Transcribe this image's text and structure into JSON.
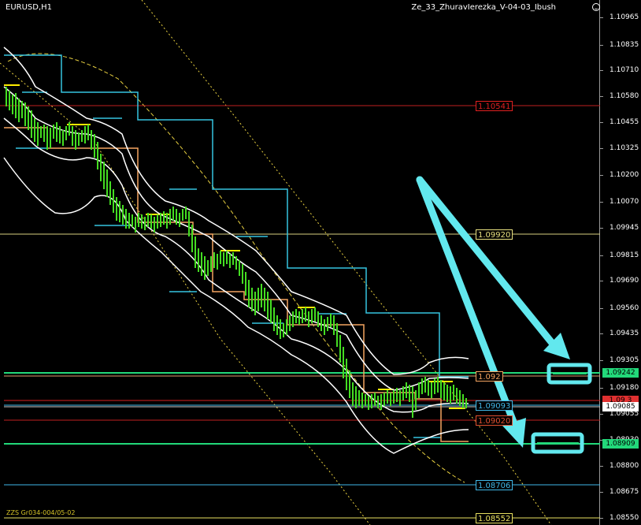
{
  "window": {
    "symbol": "EURUSD,H1",
    "indicator": "Ze_33_ZhuravIerezka_V-04-03_Ibush",
    "bottom_note": "ZZS Gr034-004/05-02"
  },
  "price_axis": {
    "ticks": [
      "1.10965",
      "1.10835",
      "1.10710",
      "1.10580",
      "1.10455",
      "1.10325",
      "1.10200",
      "1.10070",
      "1.09945",
      "1.09815",
      "1.09690",
      "1.09560",
      "1.09435",
      "1.09305",
      "1.09180",
      "1.09055",
      "1.08930",
      "1.08800",
      "1.08675",
      "1.08550"
    ],
    "badges": [
      {
        "text": "1.09242",
        "bg": "#22d97a",
        "fg": "#000000"
      },
      {
        "text": "1.09 3",
        "bg": "#e03030",
        "fg": "#000000"
      },
      {
        "text": "1.09085",
        "bg": "#ffffff",
        "fg": "#000000"
      },
      {
        "text": "1.08909",
        "bg": "#22d97a",
        "fg": "#000000"
      }
    ]
  },
  "levels": [
    {
      "label": "1.10541",
      "color": "#e02020"
    },
    {
      "label": "1.09920",
      "color": "#e8e080"
    },
    {
      "label": "1.092",
      "color": "#f4a460"
    },
    {
      "label": "1.09093",
      "color": "#40b8e8"
    },
    {
      "label": "1.09020",
      "color": "#e05030"
    },
    {
      "label": "1.08706",
      "color": "#40b8e8"
    },
    {
      "label": "1.08552",
      "color": "#e8e060"
    }
  ],
  "colors": {
    "candles": "#44dd22",
    "band": "#ffffff",
    "cyan_steps": "#35c4e0",
    "orange_steps": "#f4a460",
    "green_hlines": "#22d97a",
    "yellow_dash": "#e8d040",
    "arrows": "#62e8ee"
  },
  "annotations": {
    "arrows": 2,
    "boxes": 2
  }
}
